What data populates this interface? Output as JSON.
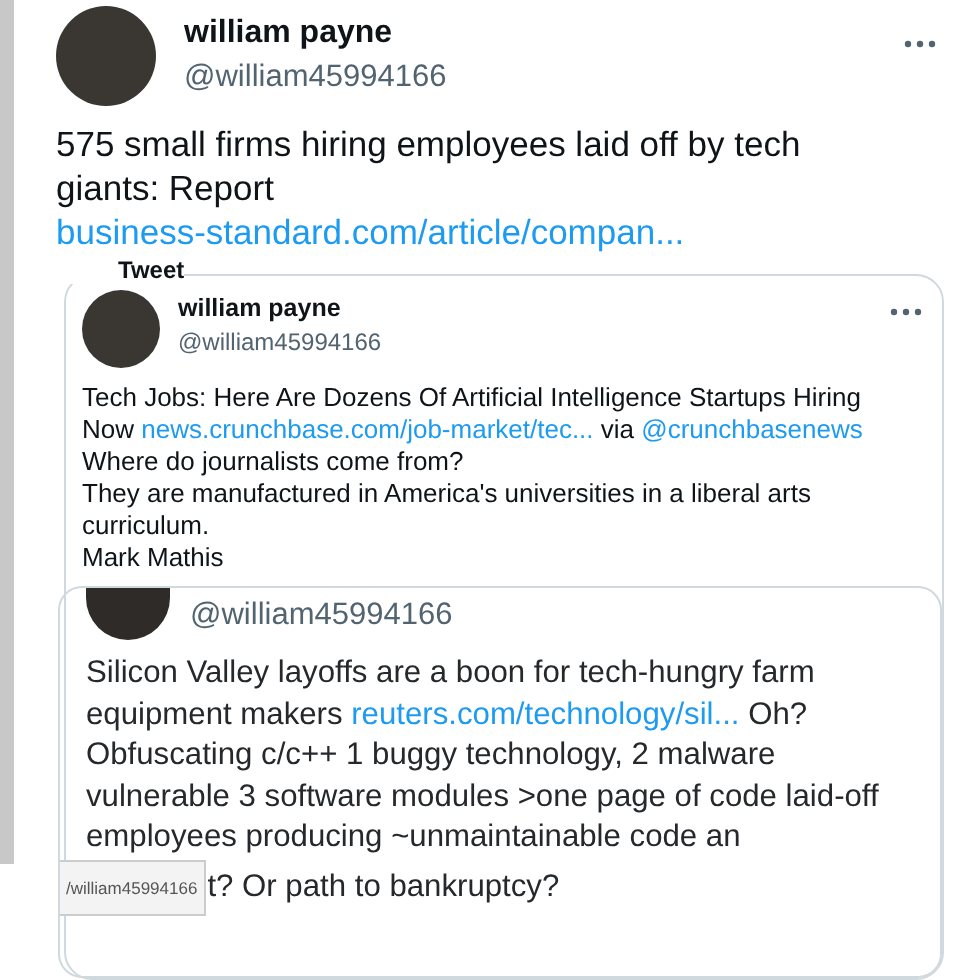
{
  "tweet": {
    "name": "william payne",
    "handle": "@william45994166",
    "text": [
      {
        "kind": "text",
        "text": "575 small firms hiring employees laid off by tech giants: Report "
      },
      {
        "kind": "link",
        "text": "business-standard.com/article/compan..."
      }
    ],
    "quoted_screenshot": {
      "header": "Tweet",
      "name": "william payne",
      "handle": "@william45994166",
      "paragraphs": [
        [
          {
            "kind": "text",
            "text": "Tech Jobs: Here Are Dozens Of Artificial Intelligence Startups Hiring Now "
          },
          {
            "kind": "link",
            "text": "news.crunchbase.com/job-market/tec..."
          },
          {
            "kind": "text",
            "text": " via "
          },
          {
            "kind": "link",
            "text": "@crunchbasenews"
          }
        ],
        [
          {
            "kind": "text",
            "text": "Where do journalists come from?"
          }
        ],
        [
          {
            "kind": "text",
            "text": "They are manufactured in America's universities in a liberal arts curriculum."
          }
        ],
        [
          {
            "kind": "text",
            "text": "Mark Mathis"
          }
        ]
      ],
      "quote": {
        "handle": "@william45994166",
        "text": [
          {
            "kind": "text",
            "text": "Silicon Valley layoffs are a boon for tech-hungry farm equipment makers "
          },
          {
            "kind": "link",
            "text": "reuters.com/technology/sil..."
          },
          {
            "kind": "text",
            "text": " Oh? Obfuscating c/c++ 1 buggy technology, 2 malware vulnerable 3 software modules >one page of code laid-off employees producing ~unmaintainable code an"
          }
        ],
        "last_line": "t? Or path to  bankruptcy?"
      }
    }
  },
  "status_tooltip": "/william45994166"
}
